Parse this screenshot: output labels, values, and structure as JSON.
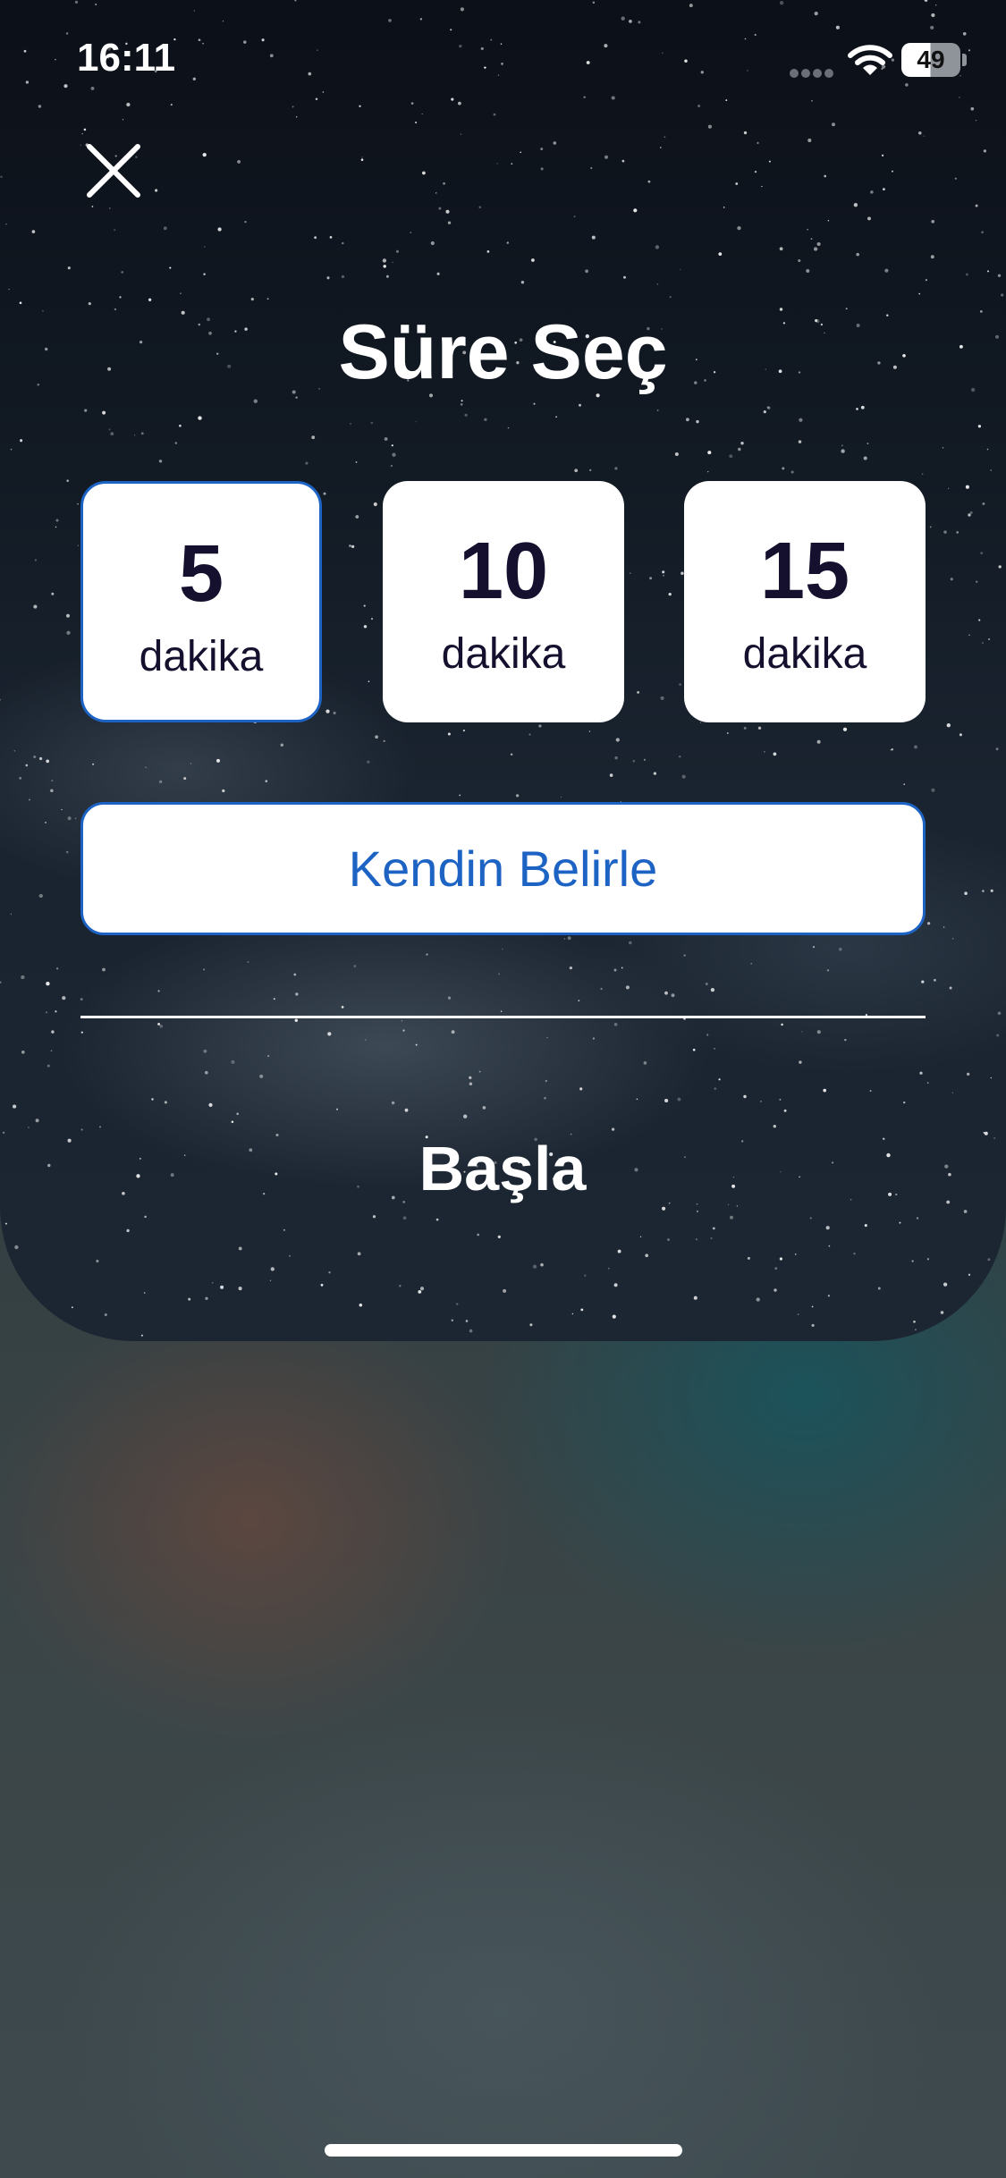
{
  "status_bar": {
    "time": "16:11",
    "battery_level": "49",
    "battery_fraction": 0.49,
    "icons": [
      "signal-icon",
      "wifi-icon",
      "battery-icon"
    ]
  },
  "header": {
    "close_icon": "close-icon",
    "title": "Süre Seç"
  },
  "durations": [
    {
      "value": "5",
      "unit": "dakika",
      "selected": true
    },
    {
      "value": "10",
      "unit": "dakika",
      "selected": false
    },
    {
      "value": "15",
      "unit": "dakika",
      "selected": false
    }
  ],
  "custom_button": {
    "label": "Kendin Belirle"
  },
  "start_button": {
    "label": "Başla"
  },
  "colors": {
    "accent": "#1c63c4",
    "card_text": "#14102e",
    "sheet_dark": "#121a24"
  }
}
